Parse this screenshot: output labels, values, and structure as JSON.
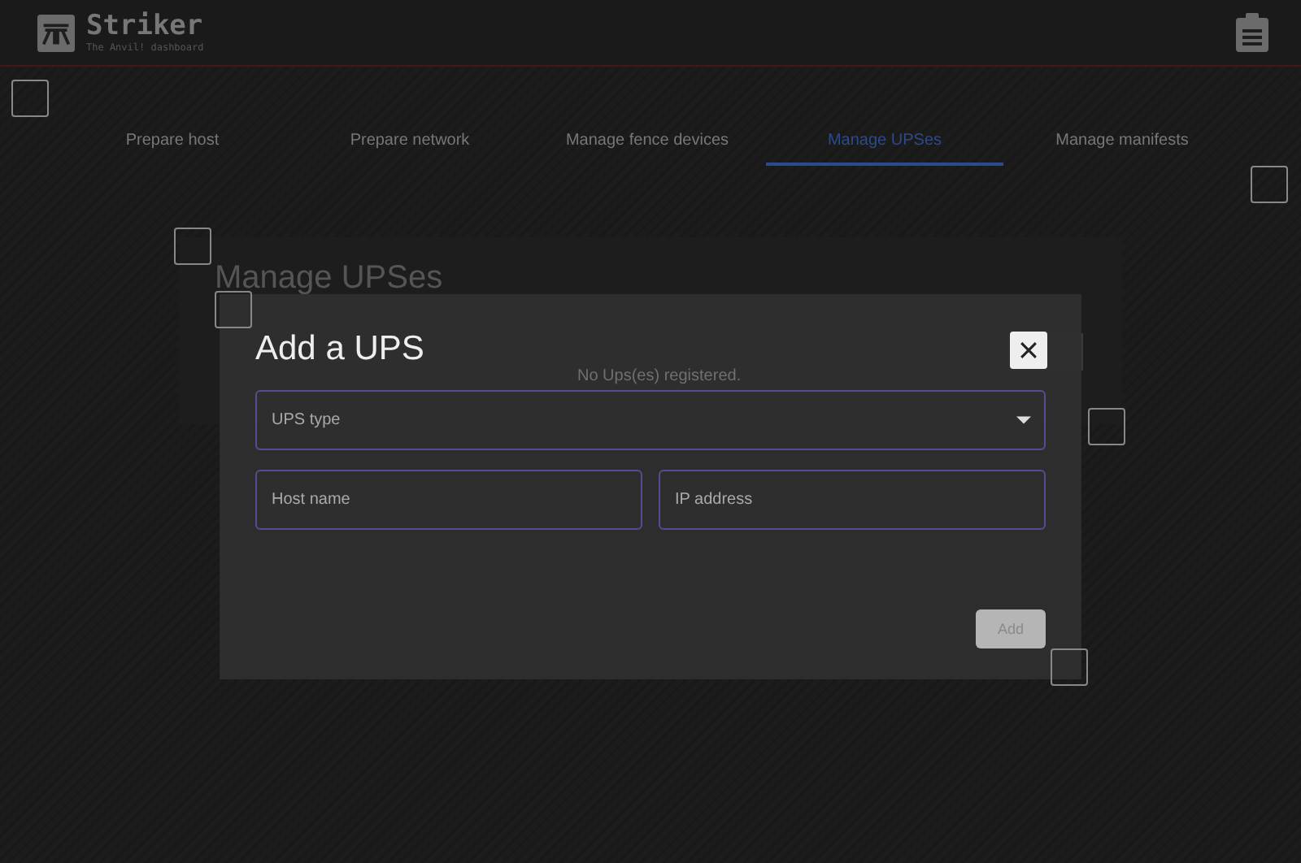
{
  "header": {
    "title": "Striker",
    "subtitle": "The Anvil! dashboard"
  },
  "tabs": [
    {
      "label": "Prepare host",
      "selected": false
    },
    {
      "label": "Prepare network",
      "selected": false
    },
    {
      "label": "Manage fence devices",
      "selected": false
    },
    {
      "label": "Manage UPSes",
      "selected": true
    },
    {
      "label": "Manage manifests",
      "selected": false
    }
  ],
  "panel": {
    "title": "Manage UPSes",
    "empty_message": "No Ups(es) registered."
  },
  "dialog": {
    "title": "Add a UPS",
    "fields": [
      {
        "kind": "select",
        "placeholder": "UPS type"
      },
      {
        "kind": "text",
        "placeholder": "Host name"
      },
      {
        "kind": "text",
        "placeholder": "IP address"
      }
    ],
    "submit": {
      "label": "Add",
      "disabled": true
    }
  }
}
